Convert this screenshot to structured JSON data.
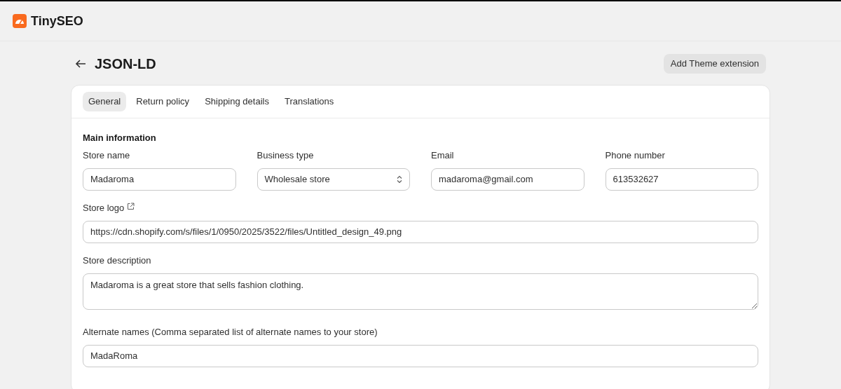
{
  "app": {
    "name": "TinySEO"
  },
  "page": {
    "title": "JSON-LD",
    "action": "Add Theme extension"
  },
  "tabs": [
    {
      "label": "General",
      "selected": true
    },
    {
      "label": "Return policy",
      "selected": false
    },
    {
      "label": "Shipping details",
      "selected": false
    },
    {
      "label": "Translations",
      "selected": false
    }
  ],
  "section_title": "Main information",
  "row_fields": [
    {
      "kind": "text",
      "label": "Store name",
      "value": "Madaroma"
    },
    {
      "kind": "select",
      "label": "Business type",
      "value": "Wholesale store"
    },
    {
      "kind": "text",
      "label": "Email",
      "value": "madaroma@gmail.com"
    },
    {
      "kind": "text",
      "label": "Phone number",
      "value": "613532627"
    }
  ],
  "fields": [
    {
      "kind": "text",
      "label": "Store logo",
      "external_link": true,
      "value": "https://cdn.shopify.com/s/files/1/0950/2025/3522/files/Untitled_design_49.png"
    },
    {
      "kind": "textarea",
      "label": "Store description",
      "value": "Madaroma is a great store that sells fashion clothing."
    },
    {
      "kind": "text",
      "label": "Alternate names (Comma separated list of alternate names to your store)",
      "value": "MadaRoma"
    }
  ]
}
